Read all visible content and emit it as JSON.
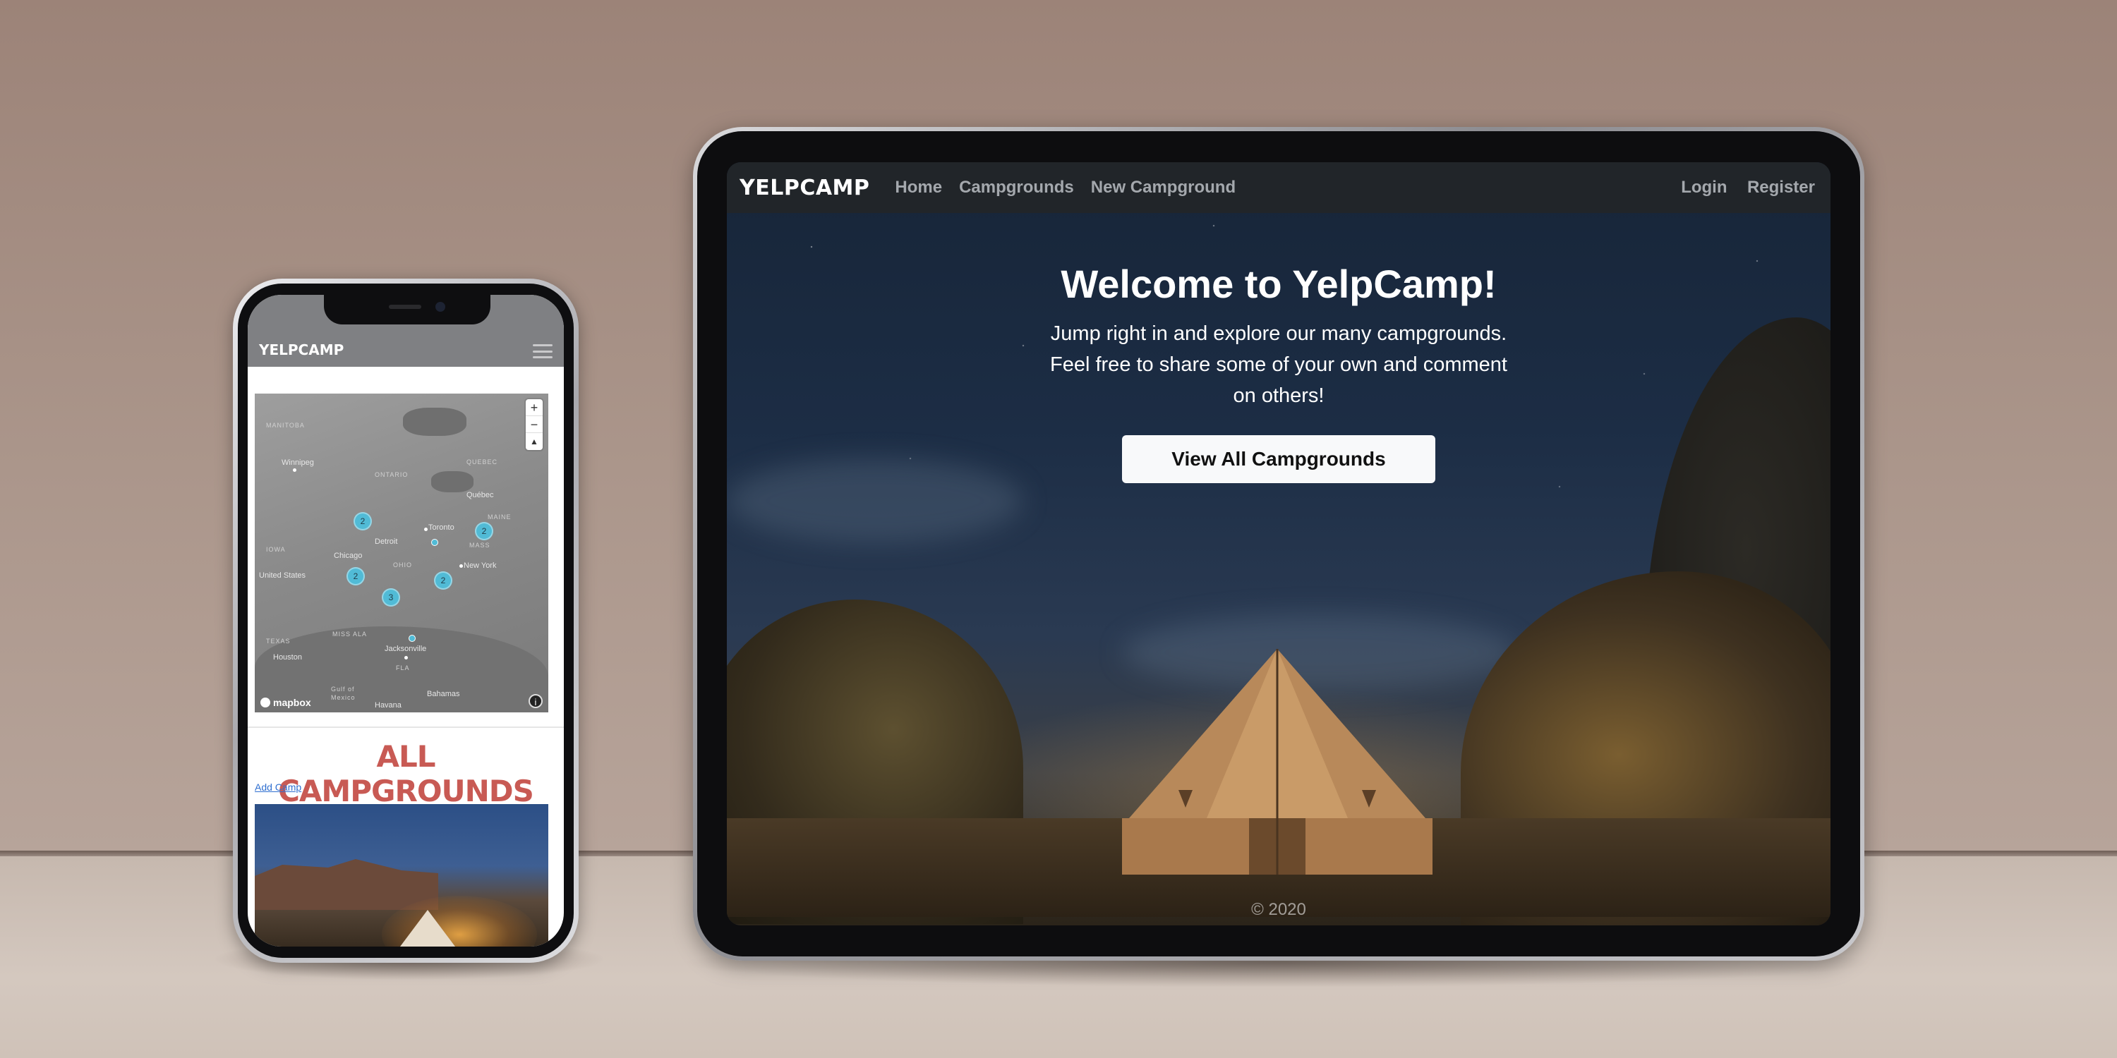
{
  "tablet": {
    "navbar": {
      "brand": "YELPCAMP",
      "links": [
        "Home",
        "Campgrounds",
        "New Campground"
      ],
      "auth_links": [
        "Login",
        "Register"
      ]
    },
    "hero": {
      "title": "Welcome to YelpCamp!",
      "text_lines": [
        "Jump right in and explore our many campgrounds.",
        "Feel free to share some of your own and comment",
        "on others!"
      ],
      "button": "View All Campgrounds"
    },
    "footer": "© 2020"
  },
  "phone": {
    "navbar": {
      "brand": "YELPCAMP",
      "menu_icon": "hamburger-icon"
    },
    "map": {
      "labels": {
        "manitoba": "MANITOBA",
        "ontario": "ONTARIO",
        "quebec": "QUEBEC",
        "winnipeg": "Winnipeg",
        "quebec_city": "Québec",
        "toronto": "Toronto",
        "detroit": "Detroit",
        "chicago": "Chicago",
        "new_york": "New York",
        "united_states": "United States",
        "houston": "Houston",
        "jacksonville": "Jacksonville",
        "gulf": "Gulf of",
        "mexico": "Mexico",
        "havana": "Havana",
        "bahamas": "Bahamas",
        "texas": "TEXAS",
        "iowa": "IOWA",
        "ohio": "OHIO",
        "miss": "MISS ALA",
        "mass": "MASS",
        "maine": "MAINE",
        "fla": "FLA"
      },
      "clusters": [
        "2",
        "2",
        "2",
        "3",
        "2"
      ],
      "controls": {
        "zoom_in": "+",
        "zoom_out": "−",
        "compass": "▲"
      },
      "attribution": "mapbox",
      "info": "i"
    },
    "title": "ALL CAMPGROUNDS",
    "add_link": "Add Camp"
  },
  "colors": {
    "navbar_dark": "#212529",
    "mobile_title": "#c85a54",
    "cluster": "#51bbd6",
    "link": "#2f6fd0"
  }
}
